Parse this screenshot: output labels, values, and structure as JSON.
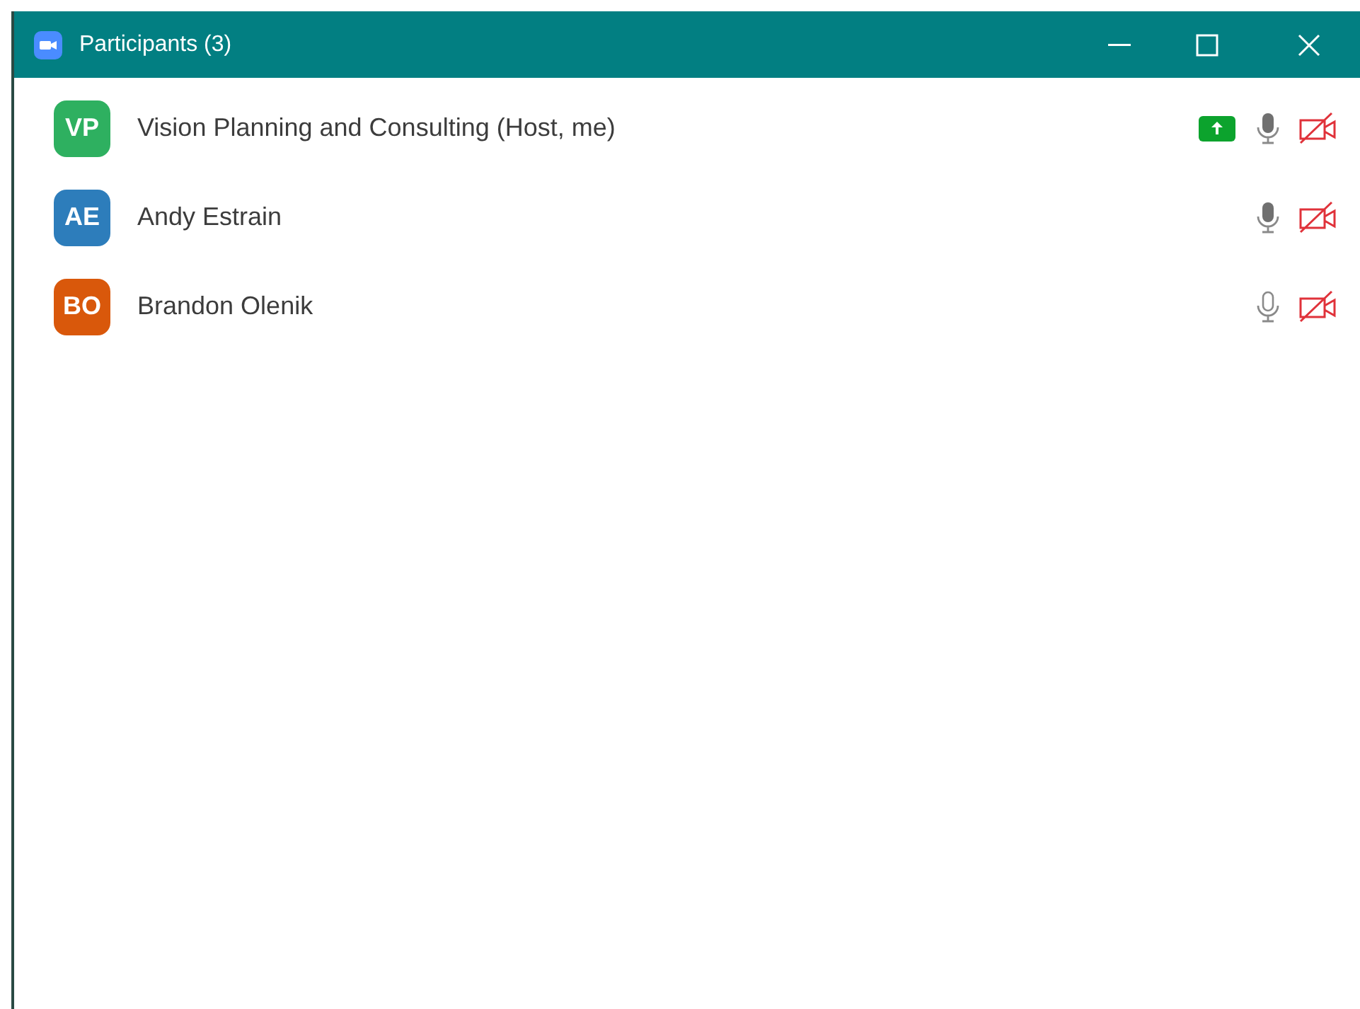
{
  "window": {
    "title": "Participants (3)"
  },
  "participants": [
    {
      "initials": "VP",
      "name": "Vision Planning and Consulting (Host, me)",
      "color": "#2eb060",
      "sharing": true,
      "mic_filled": true,
      "video_off": true
    },
    {
      "initials": "AE",
      "name": "Andy Estrain",
      "color": "#2d7dbb",
      "sharing": false,
      "mic_filled": true,
      "video_off": true
    },
    {
      "initials": "BO",
      "name": "Brandon Olenik",
      "color": "#d9580b",
      "sharing": false,
      "mic_filled": false,
      "video_off": true
    }
  ]
}
